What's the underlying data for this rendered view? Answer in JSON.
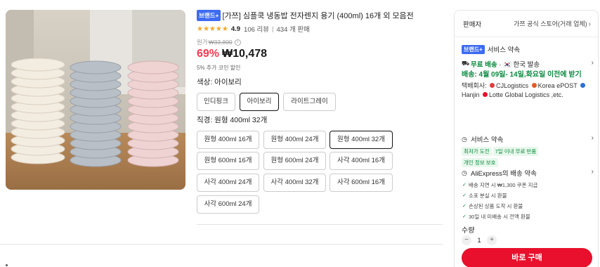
{
  "product": {
    "badge": "브랜드+",
    "title": "[가쯔] 심플쿡 냉동밥 전자렌지 용기 (400ml) 16개 외 모음전",
    "stars": "★★★★★",
    "rating": "4.9",
    "reviews": "106 리뷰",
    "sold": "434 개 판매",
    "original_label": "원가",
    "original_price": "₩33,800",
    "discount": "69%",
    "price": "₩10,478",
    "coin_note": "5% 추가 코인 할인"
  },
  "color": {
    "label": "색상: 아이보리",
    "options": [
      "인디핑크",
      "아이보리",
      "라이트그레이"
    ],
    "selected": "아이보리"
  },
  "spec": {
    "label": "직경: 원형 400ml 32개",
    "options": [
      "원형 400ml 16개",
      "원형 400ml 24개",
      "원형 400ml 32개",
      "원형 600ml 16개",
      "원형 600ml 24개",
      "사각 400ml 16개",
      "사각 400ml 24개",
      "사각 400ml 32개",
      "사각 600ml 16개",
      "사각 600ml 24개"
    ],
    "selected": "원형 400ml 32개"
  },
  "panel": {
    "seller_label": "판매자",
    "seller_name": "가쯔 공식 스토어(거래 업체)",
    "promise_badge": "브랜드+",
    "promise_title": "서비스 약속",
    "shipping": {
      "free": "무료 배송",
      "from": "· 🇰🇷 한국 발송",
      "delivery": "배송: 4월 09일- 14일,화요일 이전에 받기",
      "carriers_label": "택배회사:",
      "carriers": [
        "CJLogistics",
        "Korea ePOST",
        "Hanjin",
        "Lotte Global Logistics ,etc."
      ]
    },
    "service": {
      "title": "서비스 약속",
      "tags": [
        "최저가 도전",
        "7일 이내 무료 반품",
        "개인 정보 보호"
      ]
    },
    "ali": {
      "title": "AliExpress의 배송 약속",
      "items": [
        "배송 지연 시 ₩1,300 쿠폰 지급",
        "소포 분실 시 환불",
        "손상된 상품 도착 시 환불",
        "30일 내 미배송 시 전액 환불"
      ]
    },
    "qty_label": "수량",
    "qty": "1",
    "minus": "−",
    "plus": "+",
    "buy": "바로 구매"
  },
  "colors": {
    "accent_red": "#e8102c",
    "discount_red": "#fd384f",
    "brand_blue": "#3d6bf2",
    "green": "#0a8a3f"
  }
}
